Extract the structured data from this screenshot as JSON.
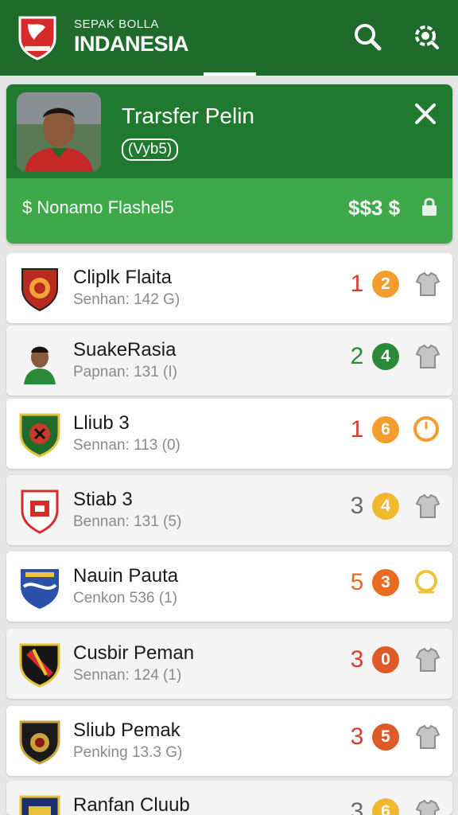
{
  "header": {
    "brand_small": "SEPAK BOLLA",
    "brand_big": "INDANESIA",
    "logo_icon": "club-shield-logo",
    "actions": [
      {
        "icon": "search-icon"
      },
      {
        "icon": "search-settings-icon"
      }
    ],
    "accent": "#1e6b2c"
  },
  "transfer": {
    "title": "Trarsfer Pelin",
    "badge": "(Vyb5)",
    "close_icon": "close-icon",
    "left_text": "$ Nonamo   Flashel5",
    "right_text": "$$3 $",
    "right_icon": "lock-icon",
    "top_color": "#1f7a30",
    "bottom_color": "#3da94a"
  },
  "clubs": [
    {
      "name": "Cliplk Flaita",
      "sub": "Senhan: 142 G)",
      "num": "1",
      "num_color": "#d93a2b",
      "badge": "2",
      "badge_color": "#f29d2e",
      "icon": "shirt-icon",
      "logo": "club-logo-red"
    },
    {
      "name": "SuakeRasia",
      "sub": "Papnan: 131 (I)",
      "num": "2",
      "num_color": "#2a8a3a",
      "badge": "4",
      "badge_color": "#2a8a3a",
      "icon": "shirt-icon",
      "logo": "player-avatar"
    },
    {
      "name": "Lliub 3",
      "sub": "Sennan: 113 (0)",
      "num": "1",
      "num_color": "#d93a2b",
      "badge": "6",
      "badge_color": "#f29d2e",
      "icon": "clock-icon",
      "logo": "club-logo-green"
    },
    {
      "name": "Stiab 3",
      "sub": "Bennan: 131 (5)",
      "num": "3",
      "num_color": "#6a6a6a",
      "badge": "4",
      "badge_color": "#f2b82e",
      "icon": "shirt-icon",
      "logo": "club-logo-white-red"
    },
    {
      "name": "Nauin Pauta",
      "sub": "Cenkon 536 (1)",
      "num": "5",
      "num_color": "#e86b22",
      "badge": "3",
      "badge_color": "#e86b22",
      "icon": "ring-icon",
      "logo": "club-logo-blue"
    },
    {
      "name": "Cusbir Peman",
      "sub": "Sennan: 124 (1)",
      "num": "3",
      "num_color": "#d93a2b",
      "badge": "0",
      "badge_color": "#e05a28",
      "icon": "shirt-icon",
      "logo": "club-logo-black-red"
    },
    {
      "name": "Sliub Pemak",
      "sub": "Penking 13.3 G)",
      "num": "3",
      "num_color": "#d93a2b",
      "badge": "5",
      "badge_color": "#e05a28",
      "icon": "shirt-icon",
      "logo": "club-logo-black-gold"
    },
    {
      "name": "Ranfan Cluub",
      "sub": "",
      "num": "3",
      "num_color": "#6a6a6a",
      "badge": "6",
      "badge_color": "#f2b82e",
      "icon": "shirt-icon",
      "logo": "club-logo-navy"
    }
  ]
}
